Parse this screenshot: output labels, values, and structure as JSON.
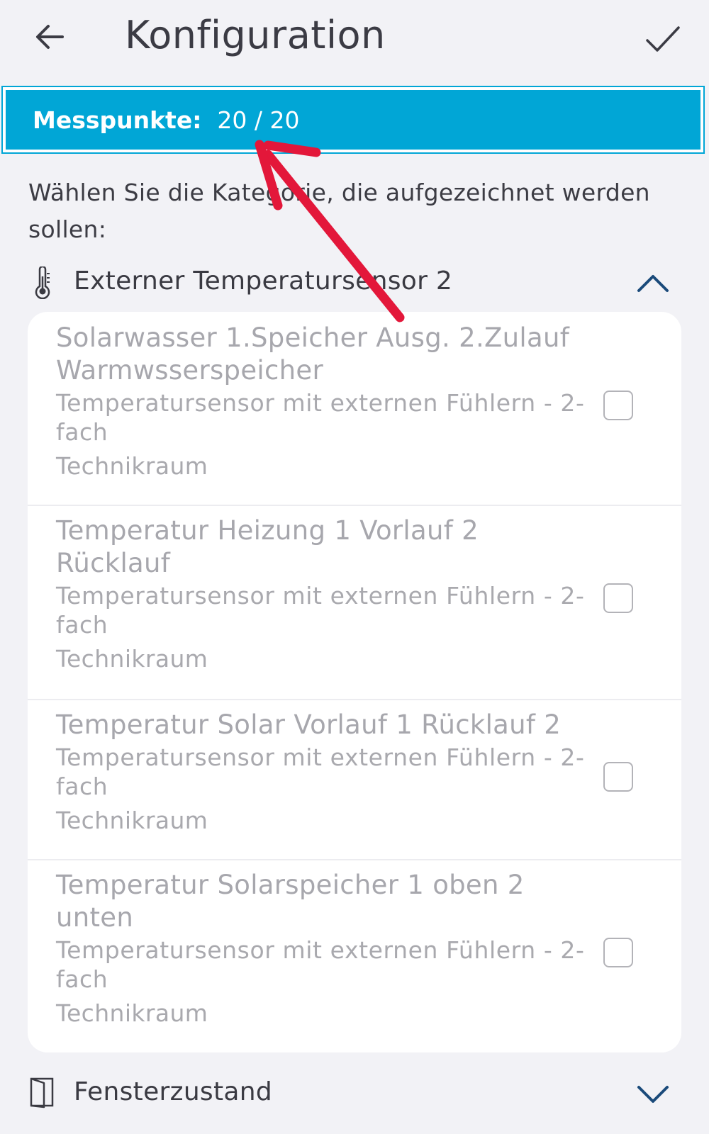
{
  "header": {
    "title": "Konfiguration",
    "back_icon": "arrow-left-icon",
    "confirm_icon": "checkmark-icon"
  },
  "banner": {
    "label": "Messpunkte:",
    "value": "20 / 20",
    "color": "#01a6d6"
  },
  "instruction": "Wählen Sie die Kategorie, die aufgezeichnet werden sollen:",
  "categories": [
    {
      "label": "Externer Temperatursensor 2",
      "icon": "thermometer-icon",
      "expanded": true,
      "chevron_icon": "chevron-up-icon",
      "items": [
        {
          "name": "Solarwasser 1.Speicher Ausg. 2.Zulauf Warmwsserspeicher",
          "type": "Temperatursensor mit externen Fühlern - 2-fach",
          "room": "Technikraum",
          "checked": false
        },
        {
          "name": "Temperatur Heizung 1 Vorlauf 2 Rücklauf",
          "type": "Temperatursensor mit externen Fühlern - 2-fach",
          "room": "Technikraum",
          "checked": false
        },
        {
          "name": "Temperatur Solar Vorlauf 1 Rücklauf 2",
          "type": "Temperatursensor mit externen Fühlern - 2-fach",
          "room": "Technikraum",
          "checked": false
        },
        {
          "name": "Temperatur Solarspeicher 1 oben 2 unten",
          "type": "Temperatursensor mit externen Fühlern - 2-fach",
          "room": "Technikraum",
          "checked": false
        }
      ]
    },
    {
      "label": "Fensterzustand",
      "icon": "window-icon",
      "expanded": false,
      "chevron_icon": "chevron-down-icon"
    }
  ],
  "annotation": {
    "icon": "red-arrow-icon",
    "color": "#e3173a"
  }
}
